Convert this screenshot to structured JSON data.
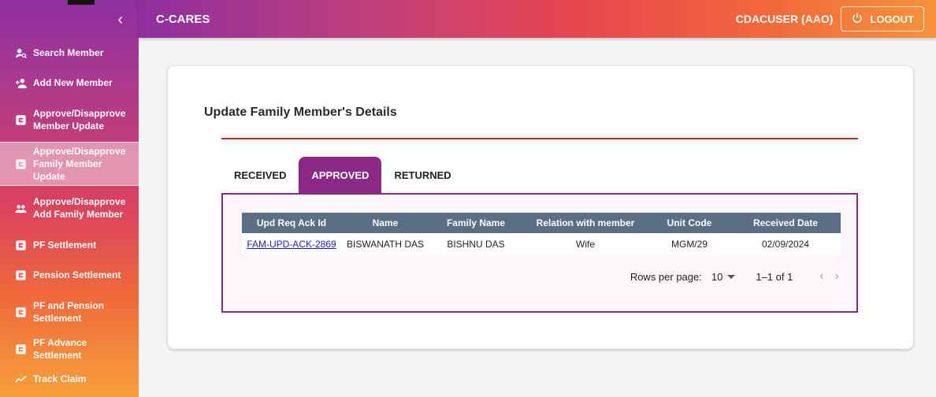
{
  "app": {
    "title": "C-CARES",
    "user": "CDACUSER (AAO)",
    "logout_label": "LOGOUT"
  },
  "sidebar": {
    "items": [
      {
        "label": "Search Member",
        "icon": "search-user-icon"
      },
      {
        "label": "Add New Member",
        "icon": "add-user-icon"
      },
      {
        "label": "Approve/Disapprove Member Update",
        "icon": "document-icon"
      },
      {
        "label": "Approve/Disapprove Family Member Update",
        "icon": "document-icon"
      },
      {
        "label": "Approve/Disapprove Add Family Member",
        "icon": "group-icon"
      },
      {
        "label": "PF Settlement",
        "icon": "document-icon"
      },
      {
        "label": "Pension Settlement",
        "icon": "document-icon"
      },
      {
        "label": "PF and Pension Settlement",
        "icon": "document-icon"
      },
      {
        "label": "PF Advance Settlement",
        "icon": "document-icon"
      },
      {
        "label": "Track Claim",
        "icon": "trend-icon"
      }
    ]
  },
  "main": {
    "title": "Update Family Member's Details",
    "tabs": [
      {
        "label": "RECEIVED"
      },
      {
        "label": "APPROVED"
      },
      {
        "label": "RETURNED"
      }
    ],
    "table": {
      "headers": [
        "Upd Req Ack Id",
        "Name",
        "Family Name",
        "Relation with member",
        "Unit Code",
        "Received Date"
      ],
      "rows": [
        [
          "FAM-UPD-ACK-2869",
          "BISWANATH DAS",
          "BISHNU DAS",
          "Wife",
          "MGM/29",
          "02/09/2024"
        ]
      ]
    },
    "pagination": {
      "rows_label": "Rows per page:",
      "rows_value": "10",
      "range": "1–1 of 1"
    }
  },
  "colors": {
    "accent": "#8b2a86",
    "header_row": "#5a6e84",
    "divider": "#d4212a"
  }
}
